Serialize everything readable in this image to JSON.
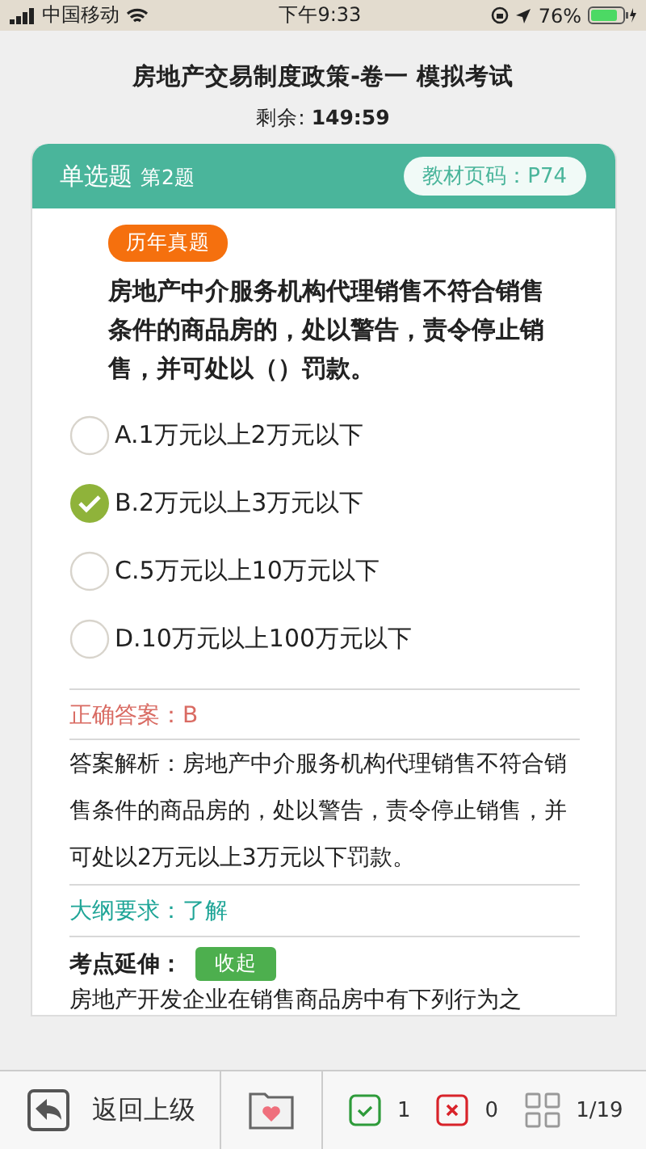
{
  "status_bar": {
    "carrier": "中国移动",
    "time": "下午9:33",
    "battery": "76%"
  },
  "header": {
    "title": "房地产交易制度政策-卷一 模拟考试",
    "timer_label": "剩余:",
    "timer_value": "149:59"
  },
  "question": {
    "type": "单选题",
    "number": "第2题",
    "page_ref": "教材页码：P74",
    "tag": "历年真题",
    "text": "房地产中介服务机构代理销售不符合销售条件的商品房的，处以警告，责令停止销售，并可处以（）罚款。",
    "options": [
      {
        "label": "A.1万元以上2万元以下",
        "selected": false
      },
      {
        "label": "B.2万元以上3万元以下",
        "selected": true
      },
      {
        "label": "C.5万元以上10万元以下",
        "selected": false
      },
      {
        "label": "D.10万元以上100万元以下",
        "selected": false
      }
    ],
    "correct_answer": "正确答案：B",
    "analysis": "答案解析：房地产中介服务机构代理销售不符合销售条件的商品房的，处以警告，责令停止销售，并可处以2万元以上3万元以下罚款。",
    "outline": "大纲要求：了解",
    "extension_label": "考点延伸：",
    "collapse_button": "收起",
    "extension_text": "房地产开发企业在销售商品房中有下列行为之"
  },
  "bottom_bar": {
    "back": "返回上级",
    "correct_count": "1",
    "wrong_count": "0",
    "progress": "1/19"
  }
}
